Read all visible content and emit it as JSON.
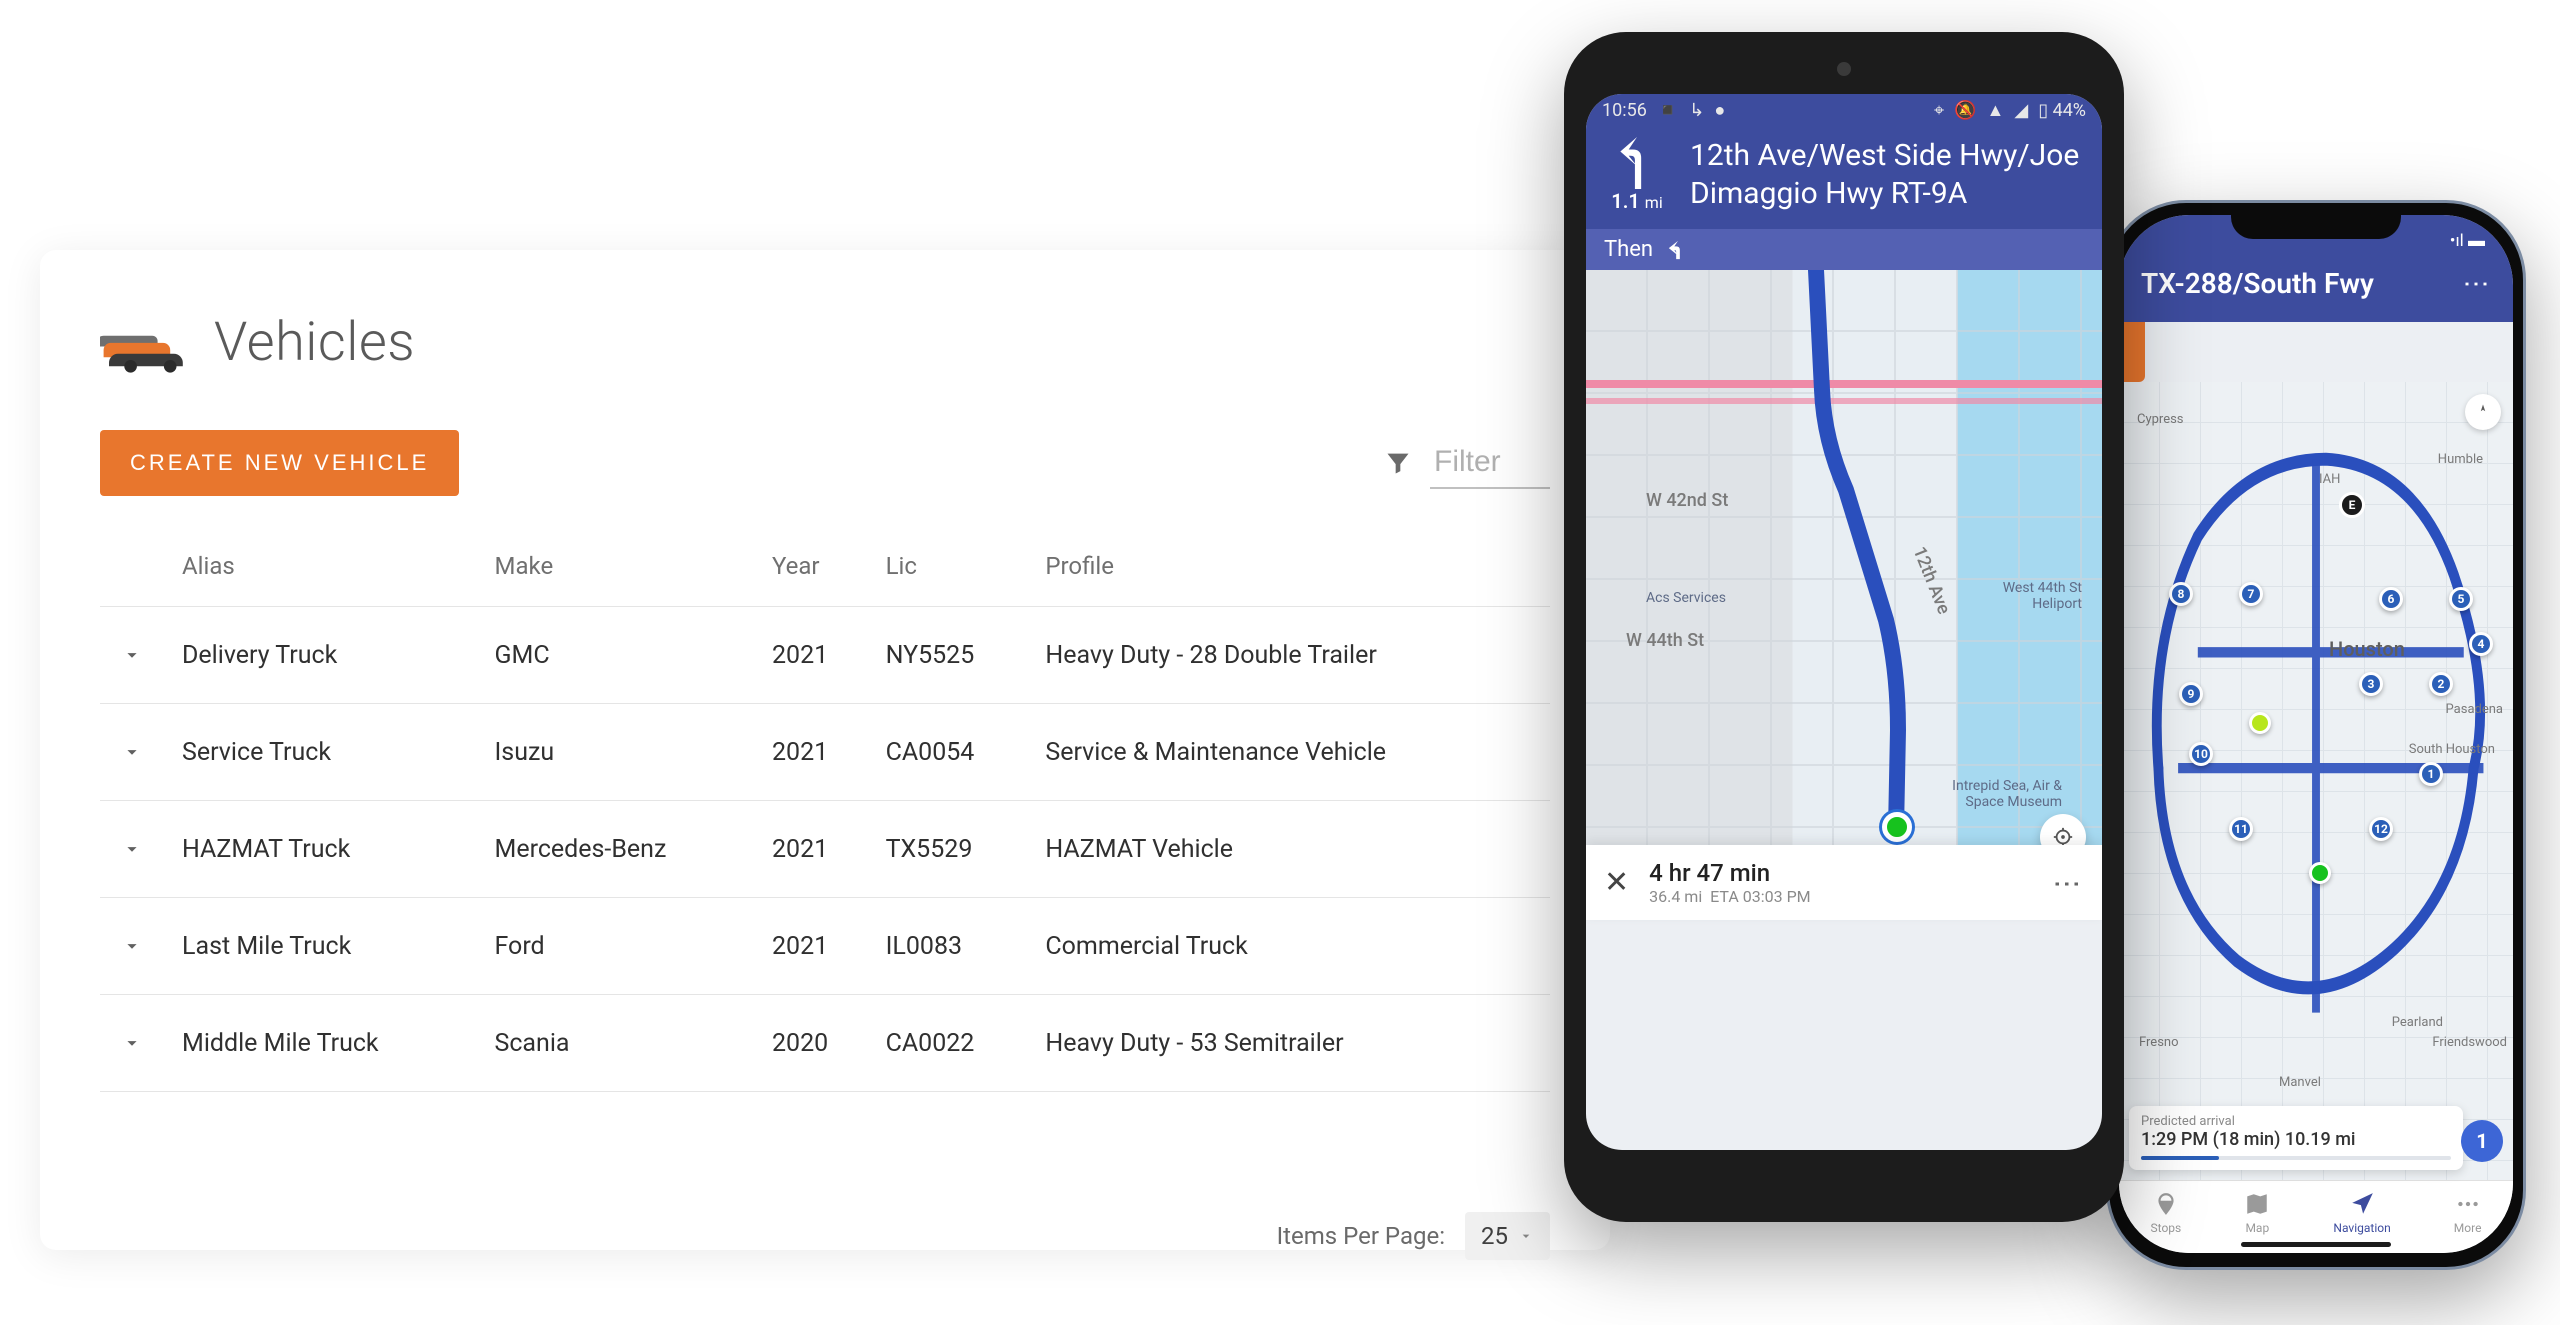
{
  "dashboard": {
    "title": "Vehicles",
    "create_button": "CREATE NEW VEHICLE",
    "filter_placeholder": "Filter",
    "columns": {
      "alias": "Alias",
      "make": "Make",
      "year": "Year",
      "lic": "Lic",
      "profile": "Profile"
    },
    "rows": [
      {
        "alias": "Delivery Truck",
        "make": "GMC",
        "year": "2021",
        "lic": "NY5525",
        "profile": "Heavy Duty - 28 Double Trailer"
      },
      {
        "alias": "Service Truck",
        "make": "Isuzu",
        "year": "2021",
        "lic": "CA0054",
        "profile": "Service & Maintenance Vehicle"
      },
      {
        "alias": "HAZMAT Truck",
        "make": "Mercedes-Benz",
        "year": "2021",
        "lic": "TX5529",
        "profile": "HAZMAT Vehicle"
      },
      {
        "alias": "Last Mile Truck",
        "make": "Ford",
        "year": "2021",
        "lic": "IL0083",
        "profile": "Commercial Truck"
      },
      {
        "alias": "Middle Mile Truck",
        "make": "Scania",
        "year": "2020",
        "lic": "CA0022",
        "profile": "Heavy Duty - 53 Semitrailer"
      }
    ],
    "pager": {
      "items_per_page_label": "Items Per Page:",
      "page_size": "25"
    }
  },
  "phone1": {
    "status": {
      "time": "10:56",
      "battery": "44%"
    },
    "nav": {
      "distance_value": "1.1",
      "distance_unit": "mi",
      "route_name": "12th Ave/West Side Hwy/Joe Dimaggio Hwy RT-9A",
      "then_label": "Then"
    },
    "streets": {
      "w42": "W 42nd St",
      "w44": "W 44th St",
      "twelfth": "12th Ave"
    },
    "poi": {
      "center_left": "Acs Services",
      "right": "West 44th St Heliport",
      "bottom_right": "Intrepid Sea, Air & Space Museum"
    },
    "trip": {
      "duration": "4 hr 47 min",
      "distance": "36.4 mi",
      "eta": "ETA 03:03 PM"
    }
  },
  "phone2": {
    "status_time": "",
    "header_road": "TX-288/South Fwy",
    "city": "Houston",
    "labels": {
      "iah": "IAH",
      "humble": "Humble",
      "pasadena": "Pasadena",
      "south_houston": "South Houston",
      "pearland": "Pearland",
      "friendswood": "Friendswood",
      "fresno": "Fresno",
      "manvel": "Manvel",
      "cypress": "Cypress"
    },
    "arrival": {
      "label": "Predicted arrival",
      "value": "1:29 PM (18 min) 10.19 mi"
    },
    "current_stop": "1",
    "nav_items": {
      "stops": "Stops",
      "map": "Map",
      "navigation": "Navigation",
      "more": "More"
    }
  }
}
